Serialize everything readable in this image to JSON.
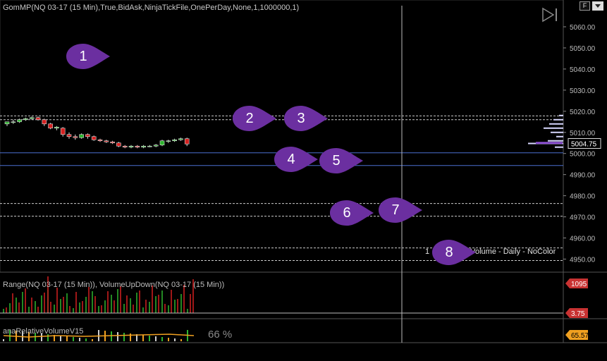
{
  "chart": {
    "title": "GomMP(NQ 03-17 (15 Min),True,BidAsk,NinjaTickFile,OnePerDay,None,1,1000000,1)",
    "price_ticks": [
      "5060.00",
      "5050.00",
      "5040.00",
      "5030.00",
      "5020.00",
      "5010.00",
      "5000.00",
      "4990.00",
      "4980.00",
      "4970.00",
      "4960.00",
      "4950.00"
    ],
    "last_price": "5004.75",
    "profile_label": "Volume - Daily - NoColor",
    "profile_prefix": "1",
    "button_f": "F"
  },
  "indicator1": {
    "title": "Range(NQ 03-17 (15 Min)), VolumeUpDown(NQ 03-17 (15 Min))",
    "value_top": "1095",
    "value_bottom": "3.75"
  },
  "indicator2": {
    "title": "anaRelativeVolumeV15",
    "percent": "66 %",
    "value": "65.57"
  },
  "markers": [
    "1",
    "2",
    "3",
    "4",
    "5",
    "6",
    "7",
    "8"
  ],
  "colors": {
    "background": "#000000",
    "up_candle": "#2fb52f",
    "down_candle": "#d42020",
    "marker": "#6b2fa0",
    "level_line_blue": "#4a6fd0",
    "level_line_white": "#cccccc",
    "badge_red": "#c83232",
    "badge_orange": "#f0a020"
  }
}
